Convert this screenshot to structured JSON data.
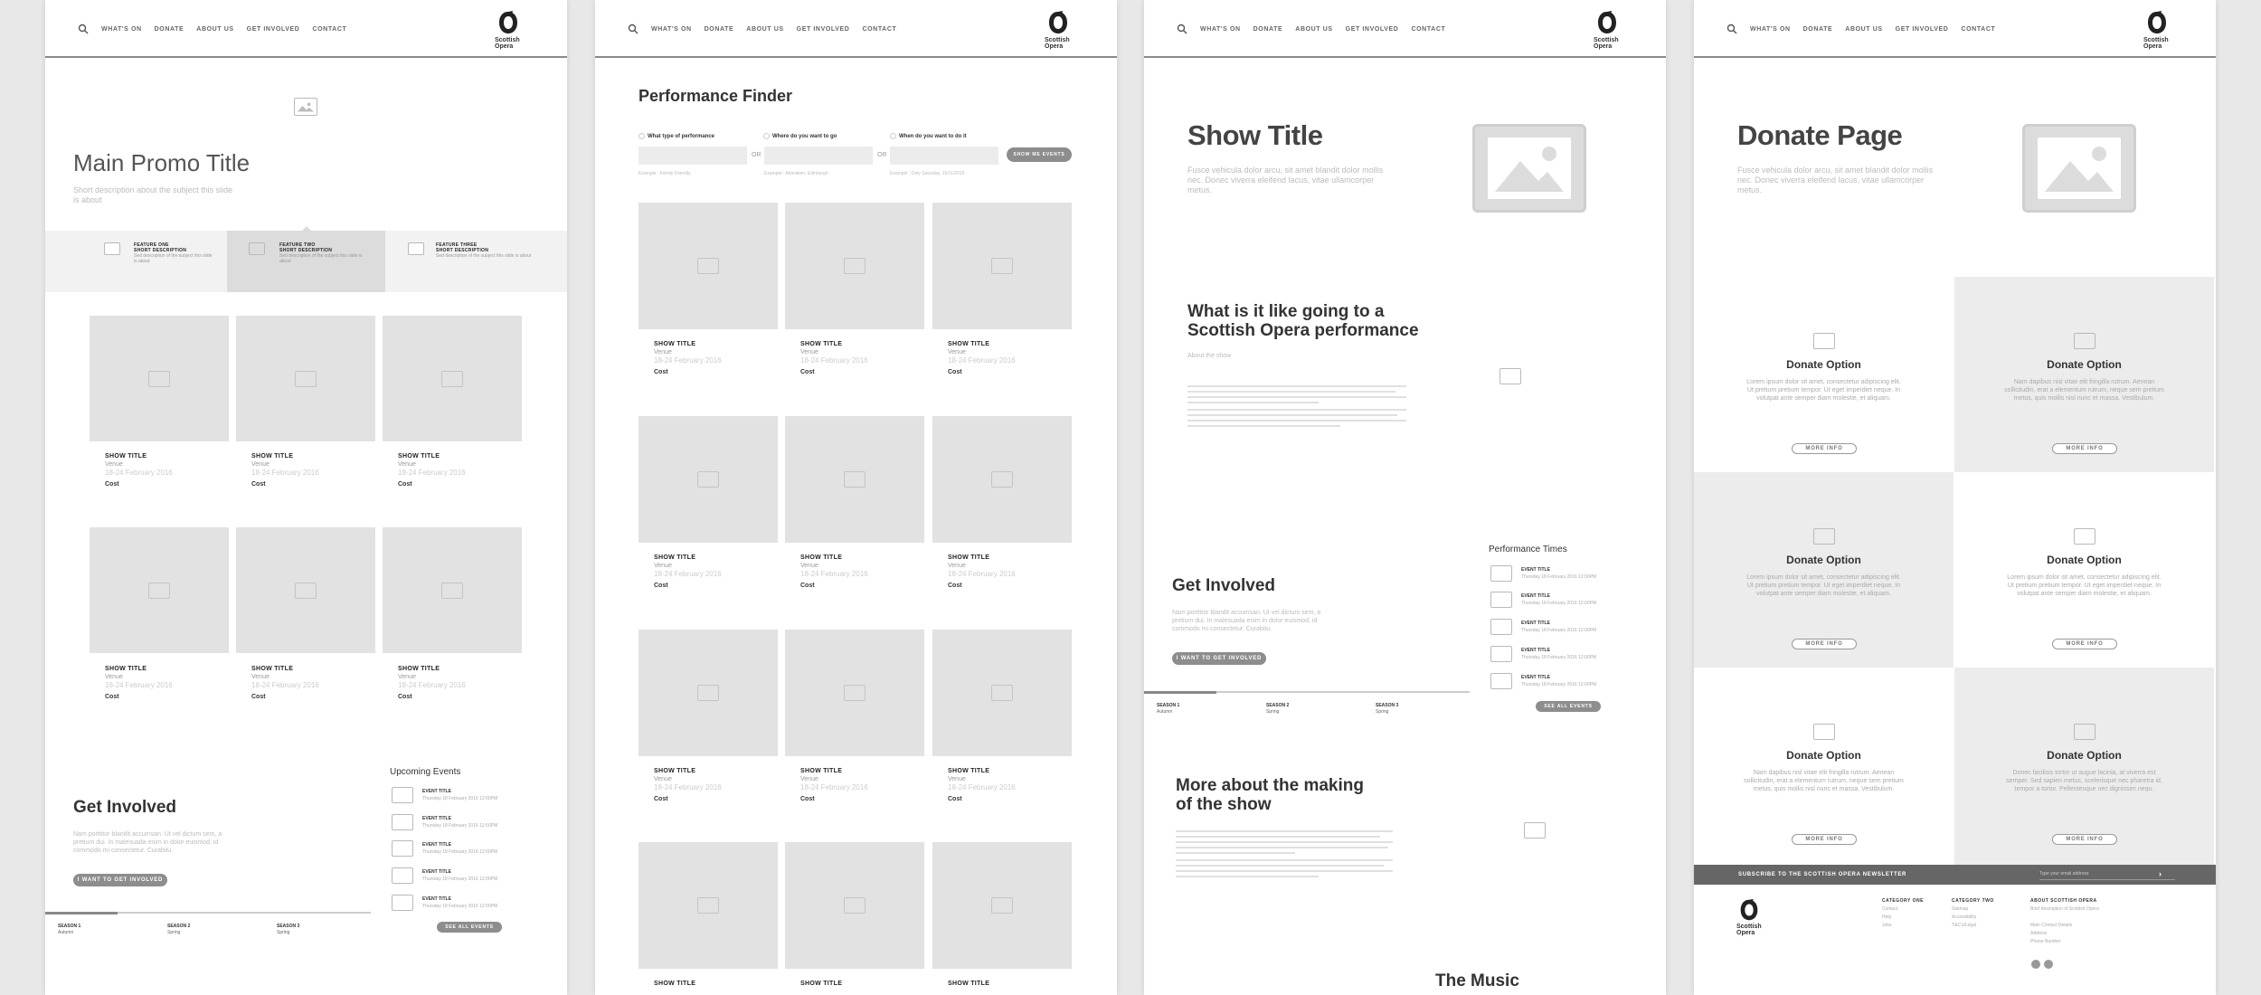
{
  "nav": {
    "items": [
      "WHAT'S ON",
      "DONATE",
      "ABOUT US",
      "GET INVOLVED",
      "CONTACT"
    ],
    "logo_line1": "Scottish",
    "logo_line2": "Opera"
  },
  "home": {
    "title": "Main Promo Title",
    "desc": "Short description about the subject this slide is about",
    "features": [
      {
        "t1": "FEATURE ONE",
        "t2": "SHORT DESCRIPTION",
        "body": "Sed description of the subject this slide is about"
      },
      {
        "t1": "FEATURE TWO",
        "t2": "SHORT DESCRIPTION",
        "body": "Sed description of the subject this slide is about"
      },
      {
        "t1": "FEATURE THREE",
        "t2": "SHORT DESCRIPTION",
        "body": "Sed description of the subject this slide is about"
      }
    ],
    "cards": [
      {
        "t": "SHOW TITLE",
        "v": "Venue",
        "d": "18-24 February 2016",
        "c": "Cost"
      },
      {
        "t": "SHOW TITLE",
        "v": "Venue",
        "d": "18-24 February 2016",
        "c": "Cost"
      },
      {
        "t": "SHOW TITLE",
        "v": "Venue",
        "d": "18-24 February 2016",
        "c": "Cost"
      },
      {
        "t": "SHOW TITLE",
        "v": "Venue",
        "d": "18-24 February 2016",
        "c": "Cost"
      },
      {
        "t": "SHOW TITLE",
        "v": "Venue",
        "d": "18-24 February 2016",
        "c": "Cost"
      },
      {
        "t": "SHOW TITLE",
        "v": "Venue",
        "d": "18-24 February 2016",
        "c": "Cost"
      }
    ],
    "gi_title": "Get Involved",
    "gi_desc": "Nam porttitor blandit accumsan. Ut vel dictum sem, a pretium dui. In malesuada enim in dolor euismod, id commodo mi consectetur. Curabitu.",
    "gi_btn": "I WANT TO GET INVOLVED",
    "up_title": "Upcoming Events",
    "events": [
      {
        "t": "EVENT TITLE",
        "d": "Thursday 18 February 2016 12:00PM"
      },
      {
        "t": "EVENT TITLE",
        "d": "Thursday 18 February 2016 12:00PM"
      },
      {
        "t": "EVENT TITLE",
        "d": "Thursday 18 February 2016 12:00PM"
      },
      {
        "t": "EVENT TITLE",
        "d": "Thursday 18 February 2016 12:00PM"
      },
      {
        "t": "EVENT TITLE",
        "d": "Thursday 18 February 2016 12:00PM"
      }
    ],
    "see_all": "SEE ALL EVENTS",
    "seasons": [
      {
        "t": "SEASON 1",
        "s": "Autumn"
      },
      {
        "t": "SEASON 2",
        "s": "Spring"
      },
      {
        "t": "SEASON 3",
        "s": "Spring"
      }
    ]
  },
  "finder": {
    "title": "Performance Finder",
    "f1": "What type of performance",
    "f2": "Where do you want to go",
    "f3": "When do you want to do it",
    "or": "OR",
    "ex1": "Example : Family Friendly",
    "ex2": "Example : Aberdeen, Edinburgh",
    "ex3": "Example : Only Saturday, 15/11/2016",
    "show": "SHOW ME EVENTS",
    "card": {
      "t": "SHOW TITLE",
      "v": "Venue",
      "d": "18-24 February 2016",
      "c": "Cost"
    }
  },
  "show": {
    "title": "Show Title",
    "desc": "Fusce vehicula dolor arcu, sit amet blandit dolor mollis nec. Donec viverra eleifend lacus, vitae ullamcorper metus.",
    "q_title": "What is it like going to a Scottish Opera performance",
    "q_sub": "About the show",
    "gi_title": "Get Involved",
    "gi_desc": "Nam porttitor blandit accumsan. Ut vel dictum sem, a pretium dui. In malesuada enim in dolor euismod, id commodo mi consectetur. Curabitu.",
    "gi_btn": "I WANT TO GET INVOLVED",
    "pt_title": "Performance Times",
    "events": [
      {
        "t": "EVENT TITLE",
        "d": "Thursday 18 February 2016 12:00PM"
      },
      {
        "t": "EVENT TITLE",
        "d": "Thursday 18 February 2016 12:00PM"
      },
      {
        "t": "EVENT TITLE",
        "d": "Thursday 18 February 2016 12:00PM"
      },
      {
        "t": "EVENT TITLE",
        "d": "Thursday 18 February 2016 12:00PM"
      },
      {
        "t": "EVENT TITLE",
        "d": "Thursday 18 February 2016 12:00PM"
      }
    ],
    "see_all": "SEE ALL EVENTS",
    "seasons": [
      {
        "t": "SEASON 1",
        "s": "Autumn"
      },
      {
        "t": "SEASON 2",
        "s": "Spring"
      },
      {
        "t": "SEASON 3",
        "s": "Spring"
      }
    ],
    "making_title": "More about the making of the show",
    "music_title": "The Music"
  },
  "donate": {
    "title": "Donate Page",
    "desc": "Fusce vehicula dolor arcu, sit amet blandit dolor mollis nec. Donec viverra eleifend lacus, vitae ullamcorper metus.",
    "option_title": "Donate Option",
    "options": [
      "Lorem ipsum dolor sit amet, consectetur adipiscing elit. Ut pretium pretium tempor. Ut eget imperdiet neque. In volutpat ante semper diam molestie, et aliquam.",
      "Nam dapibus nisl vitae elit fringilla rutrum. Aenean sollicitudin, erat a elementum rutrum, neque sem pretium metus, quis mollis nisl nunc et massa. Vestibulum.",
      "Lorem ipsum dolor sit amet, consectetur adipiscing elit. Ut pretium pretium tempor. Ut eget imperdiet neque. In volutpat ante semper diam molestie, et aliquam.",
      "Lorem ipsum dolor sit amet, consectetur adipiscing elit. Ut pretium pretium tempor. Ut eget imperdiet neque. In volutpat ante semper diam molestie, et aliquam.",
      "Nam dapibus nisl vitae elit fringilla rutrum. Aenean sollicitudin, erat a elementum rutrum, neque sem pretium metus, quis mollis nisl nunc et massa. Vestibulum.",
      "Donec facilisis tortor ut augue lacinia, at viverra est semper. Sed sapien metus, scelerisque nec pharetra id, tempor a tortor. Pellentesque nec dignissim nequ."
    ],
    "more": "MORE INFO",
    "newsletter": "SUBSCRIBE TO THE SCOTTISH OPERA NEWSLETTER",
    "email_ph": "Type your email address",
    "cat1": "CATEGORY ONE",
    "cat1_items": [
      "Contact",
      "Help",
      "Jobs"
    ],
    "cat2": "CATEGORY TWO",
    "cat2_items": [
      "Sitemap",
      "Accessibility",
      "T&C's/Legal"
    ],
    "about": "ABOUT SCOTTISH OPERA",
    "about_desc": "Brief description of Scottish Opera",
    "addr": [
      "Main Contact Details",
      "Address",
      "Phone Number"
    ]
  }
}
